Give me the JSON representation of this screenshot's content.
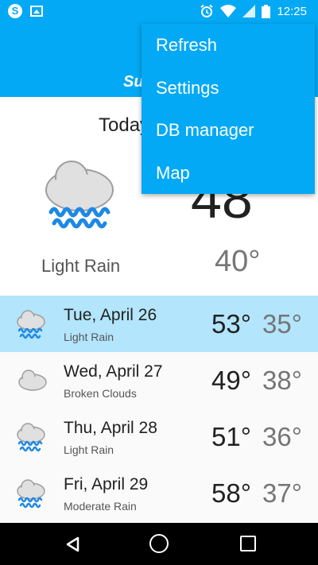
{
  "status_bar": {
    "time": "12:25",
    "left_icons": [
      "skype-icon",
      "image-icon"
    ],
    "right_icons": [
      "alarm-icon",
      "wifi-icon",
      "signal-icon",
      "battery-icon"
    ]
  },
  "app_bar": {
    "title_partial": "Su"
  },
  "today": {
    "date_label": "Today",
    "high": "48",
    "low": "40°",
    "description": "Light Rain",
    "icon": "rain-cloud-icon"
  },
  "forecast": [
    {
      "day": "Tue, April 26",
      "desc": "Light Rain",
      "high": "53°",
      "low": "35°",
      "icon": "rain-cloud-icon",
      "selected": true
    },
    {
      "day": "Wed, April 27",
      "desc": "Broken Clouds",
      "high": "49°",
      "low": "38°",
      "icon": "cloud-icon",
      "selected": false
    },
    {
      "day": "Thu, April 28",
      "desc": "Light Rain",
      "high": "51°",
      "low": "36°",
      "icon": "rain-cloud-icon",
      "selected": false
    },
    {
      "day": "Fri, April 29",
      "desc": "Moderate Rain",
      "high": "58°",
      "low": "37°",
      "icon": "rain-cloud-icon",
      "selected": false
    }
  ],
  "menu": {
    "items": [
      "Refresh",
      "Settings",
      "DB manager",
      "Map"
    ]
  },
  "colors": {
    "primary": "#03a9f4",
    "selected_row": "#b3e5fc",
    "rain_blue": "#1e88e5"
  }
}
